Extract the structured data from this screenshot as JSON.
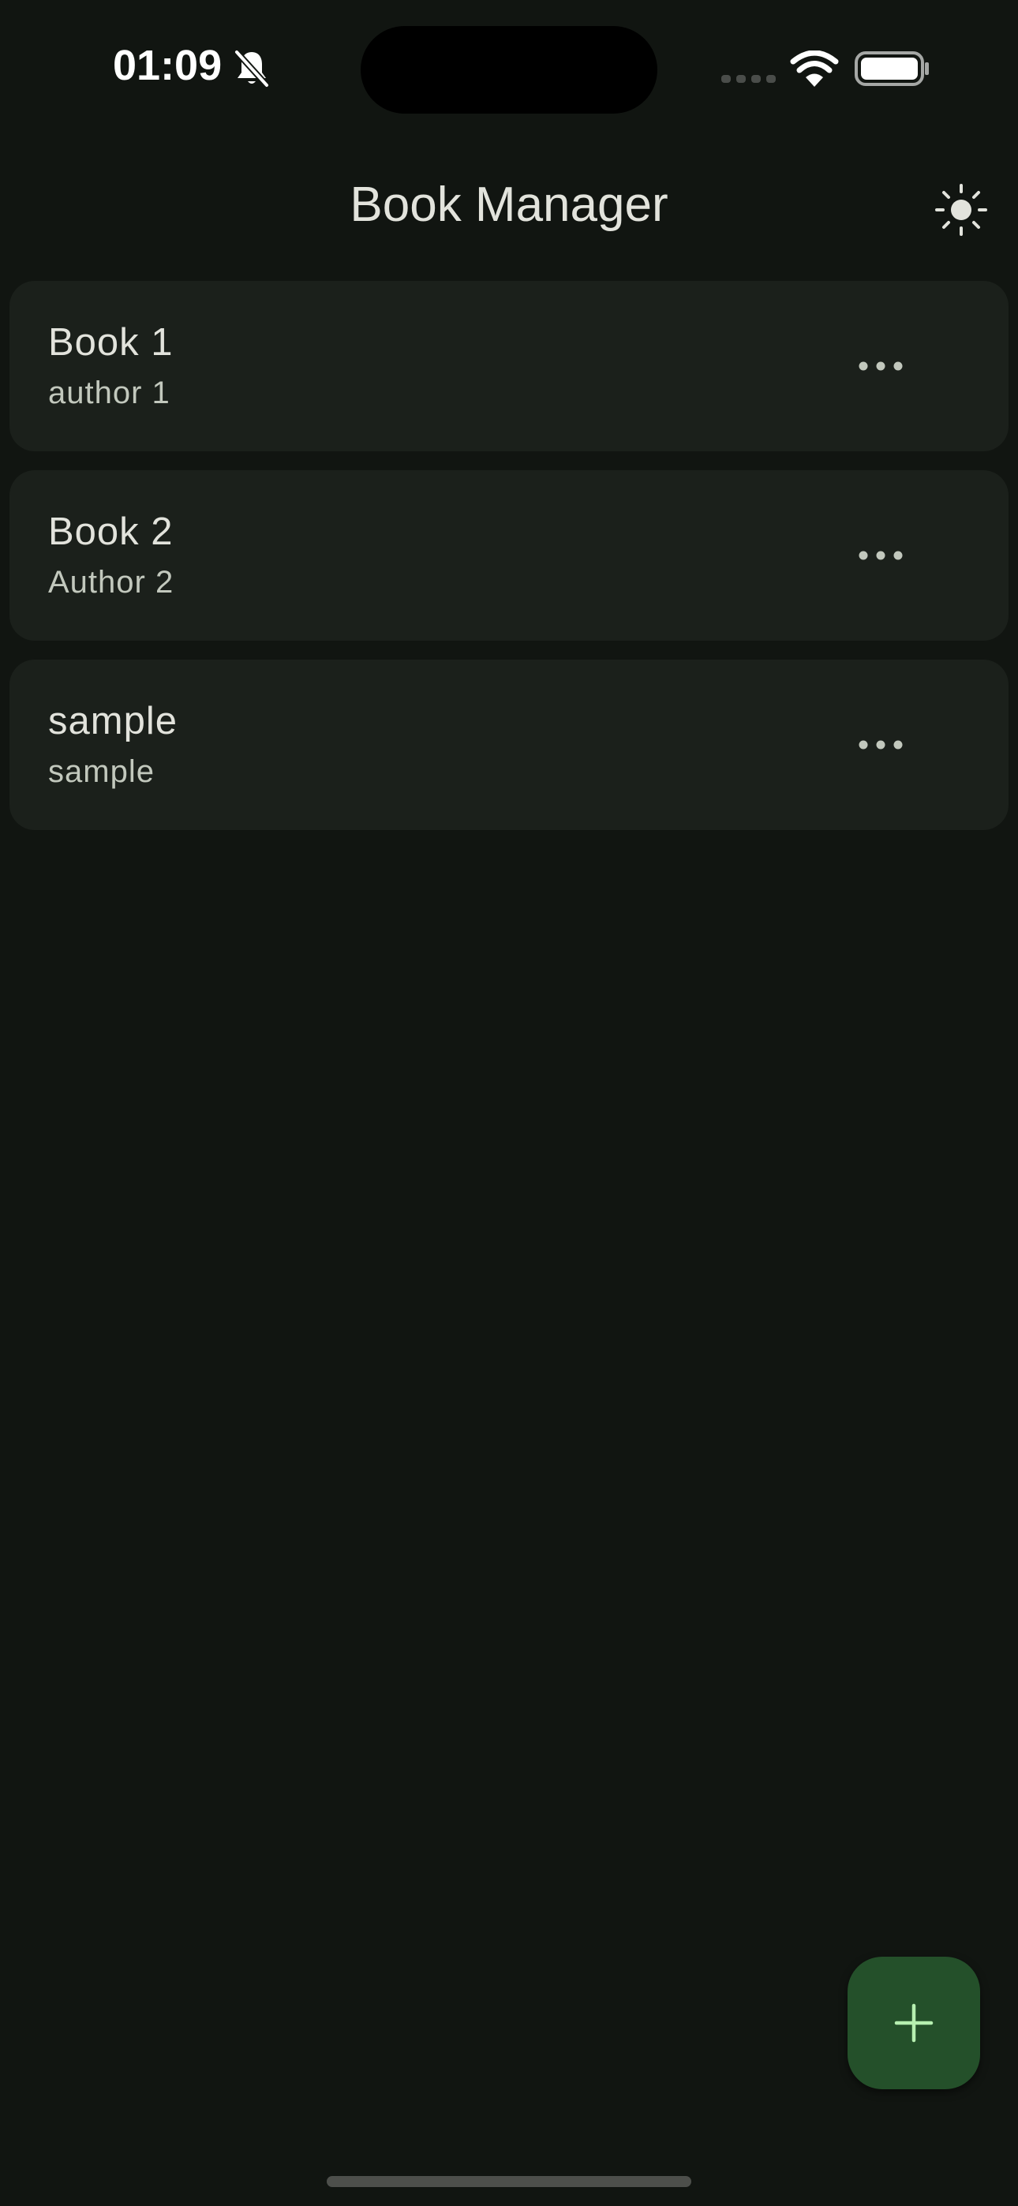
{
  "status_bar": {
    "time": "01:09",
    "icons": [
      "bell-slash-icon",
      "cellular-signal-icon",
      "wifi-icon",
      "battery-icon"
    ]
  },
  "app_bar": {
    "title": "Book Manager",
    "theme_icon": "sun-icon"
  },
  "books": [
    {
      "title": "Book 1",
      "author": "author 1"
    },
    {
      "title": "Book 2",
      "author": "Author 2"
    },
    {
      "title": "sample",
      "author": "sample"
    }
  ],
  "card_actions_icon": "more-horizontal-icon",
  "fab": {
    "icon": "plus-icon"
  },
  "colors": {
    "background": "#111511",
    "card": "#1b201b",
    "fab_background": "#24502a",
    "fab_icon": "#b6efb0",
    "text_primary": "#e2e3dc",
    "text_secondary": "#c2c8bd"
  }
}
